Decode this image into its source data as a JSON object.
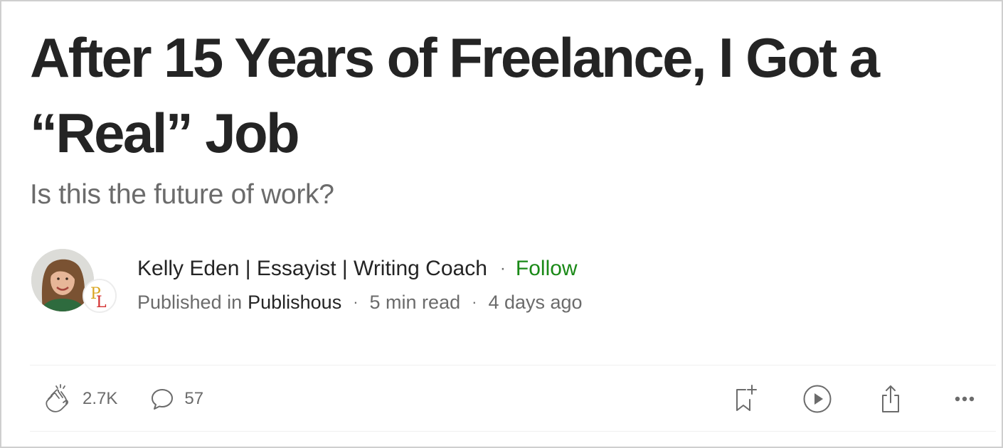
{
  "article": {
    "title_line1": "After 15 Years of Freelance, I Got a",
    "title_line2": "“Real” Job",
    "subtitle": "Is this the future of work?"
  },
  "author": {
    "name": "Kelly Eden | Essayist | Writing Coach",
    "separator": "·",
    "follow_label": "Follow",
    "avatar_icon": "author-photo",
    "publication_logo": {
      "text": "PL",
      "letter_colors": [
        "#d9a520",
        "#d32f2f"
      ]
    }
  },
  "meta": {
    "published_in_label": "Published in",
    "publication": "Publishous",
    "read_time": "5 min read",
    "age": "4 days ago",
    "separator": "·"
  },
  "actions": {
    "claps": {
      "icon": "clap-icon",
      "count": "2.7K"
    },
    "responses": {
      "icon": "comment-icon",
      "count": "57"
    },
    "save_icon": "bookmark-add-icon",
    "listen_icon": "play-icon",
    "share_icon": "share-icon",
    "more_icon": "more-icon"
  },
  "colors": {
    "text": "#242424",
    "muted": "#6b6b6b",
    "follow": "#1a8917",
    "divider": "#f0f0f0"
  }
}
